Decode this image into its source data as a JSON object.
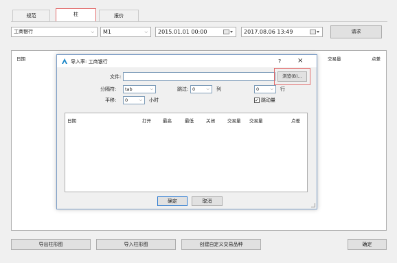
{
  "tabs": [
    "规范",
    "柱",
    "报价"
  ],
  "toolbar": {
    "symbol": "工商银行",
    "timeframe": "M1",
    "date_from": "2015.01.01 00:00",
    "date_to": "2017.08.06 13:49",
    "request_button": "请求"
  },
  "main_table": {
    "columns": [
      "日期",
      "交易量",
      "点差"
    ]
  },
  "dialog": {
    "title": "导入率: 工商银行",
    "help": "?",
    "close": "×",
    "file_label": "文件:",
    "file_value": "",
    "browse_button": "浏览(B)...",
    "separator_label": "分隔符:",
    "separator_value": "tab",
    "skip_label": "跳过:",
    "skip_value": "0",
    "column_label": "列",
    "rows_value": "0",
    "rows_label": "行",
    "shift_label": "平移:",
    "shift_value": "0",
    "hours_label": "小时",
    "tick_volume_label": "跳动量",
    "tick_volume_checked": true,
    "columns": [
      "日期",
      "打开",
      "最高",
      "最低",
      "关闭",
      "交易量",
      "交易量",
      "点差"
    ],
    "ok_button": "确定",
    "cancel_button": "取消"
  },
  "bottom_buttons": {
    "export": "导出柱形图",
    "import": "导入柱形图",
    "create": "创建自定义交易品种",
    "ok": "确定"
  },
  "colors": {
    "active_tab_border": "#e26b6b",
    "browse_highlight": "#e26b6b",
    "logo": "#1e88c8"
  }
}
